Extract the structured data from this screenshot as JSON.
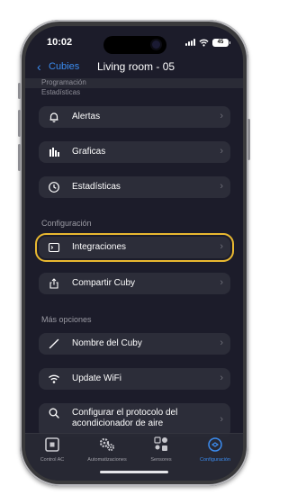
{
  "status_bar": {
    "time": "10:02",
    "battery": "45"
  },
  "nav": {
    "back_label": "Cubies",
    "title": "Living room - 05"
  },
  "sticky_section": "Programación",
  "peek_section": "Estadísticas",
  "sections": {
    "config": "Configuración",
    "more": "Más opciones"
  },
  "rows": {
    "alertas": "Alertas",
    "graficas": "Graficas",
    "estadisticas": "Estadísticas",
    "integraciones": "Integraciones",
    "compartir": "Compartir Cuby",
    "nombre": "Nombre del Cuby",
    "update_wifi": "Update WiFi",
    "protocolo_1": "Configurar el protocolo del",
    "protocolo_2": "acondicionador de aire"
  },
  "tabs": {
    "control": "Control AC",
    "automatizaciones": "Automatizaciones",
    "sensores": "Sensores",
    "configuracion": "Configuración"
  },
  "colors": {
    "accent": "#3b8cf0",
    "highlight": "#e8b830",
    "background": "#1c1c2a",
    "row": "#2c2d39"
  }
}
